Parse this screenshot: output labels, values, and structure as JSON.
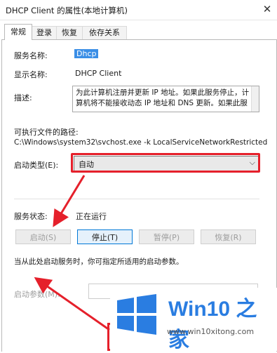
{
  "window": {
    "title": "DHCP Client 的属性(本地计算机)",
    "close_glyph": "✕"
  },
  "tabs": [
    {
      "label": "常规",
      "active": true
    },
    {
      "label": "登录",
      "active": false
    },
    {
      "label": "恢复",
      "active": false
    },
    {
      "label": "依存关系",
      "active": false
    }
  ],
  "general": {
    "service_name_label": "服务名称:",
    "service_name_value": "Dhcp",
    "display_name_label": "显示名称:",
    "display_name_value": "DHCP Client",
    "description_label": "描述:",
    "description_value": "为此计算机注册并更新 IP 地址。如果此服务停止，计算机将不能接收动态 IP 地址和 DNS 更新。如果此服",
    "exe_path_label": "可执行文件的路径:",
    "exe_path_value": "C:\\Windows\\system32\\svchost.exe -k LocalServiceNetworkRestricted",
    "startup_type_label": "启动类型(E):",
    "startup_type_value": "自动",
    "service_status_label": "服务状态:",
    "service_status_value": "正在运行",
    "hint_text": "当从此处启动服务时，你可指定所适用的启动参数。",
    "start_params_label": "启动参数(M):",
    "start_params_value": ""
  },
  "buttons": {
    "start": "启动(S)",
    "stop": "停止(T)",
    "pause": "暂停(P)",
    "resume": "恢复(R)"
  },
  "watermark": {
    "brand_text": "Win10 之家",
    "url": "www.win10xitong.com"
  },
  "colors": {
    "annotation_red": "#e5202b",
    "selection_blue": "#3a8ee6",
    "logo_blue": "#2a7de1"
  }
}
